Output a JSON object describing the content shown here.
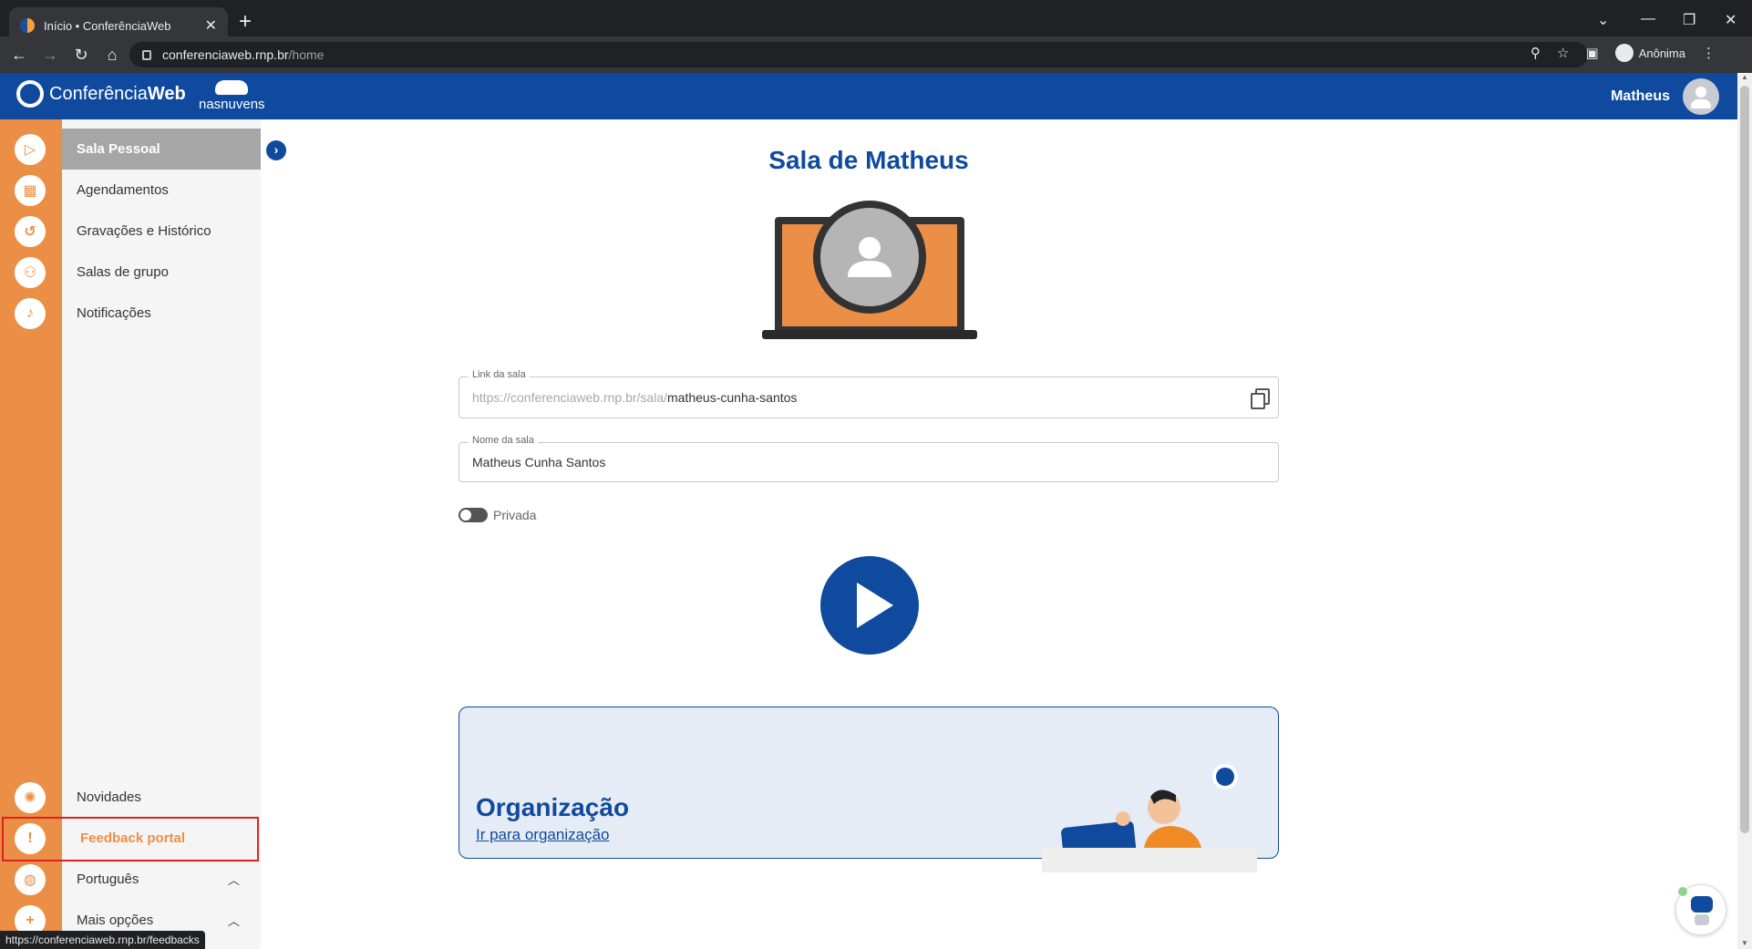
{
  "browser": {
    "tab_title": "Início • ConferênciaWeb",
    "url_host": "conferenciaweb.rnp.br",
    "url_path": "/home",
    "profile_label": "Anônima",
    "status_url": "https://conferenciaweb.rnp.br/feedbacks"
  },
  "header": {
    "logo_text_light": "Conferência",
    "logo_text_bold": "Web",
    "partner_logo": "nasnuvens",
    "user_name": "Matheus"
  },
  "sidebar": {
    "items": [
      {
        "label": "Sala Pessoal",
        "icon": "play-icon",
        "active": true
      },
      {
        "label": "Agendamentos",
        "icon": "calendar-icon"
      },
      {
        "label": "Gravações e Histórico",
        "icon": "history-icon"
      },
      {
        "label": "Salas de grupo",
        "icon": "group-icon"
      },
      {
        "label": "Notificações",
        "icon": "bell-icon"
      }
    ],
    "bottom_items": [
      {
        "label": "Novidades",
        "icon": "lightbulb-icon"
      },
      {
        "label": "Feedback portal",
        "icon": "feedback-icon"
      },
      {
        "label": "Português",
        "icon": "globe-icon"
      },
      {
        "label": "Mais opções",
        "icon": "plus-icon"
      }
    ]
  },
  "main": {
    "title": "Sala de Matheus",
    "link_field": {
      "legend": "Link da sala",
      "prefix": "https://conferenciaweb.rnp.br/sala/",
      "slug": "matheus-cunha-santos"
    },
    "name_field": {
      "legend": "Nome da sala",
      "value": "Matheus Cunha Santos"
    },
    "private_toggle": {
      "label": "Privada",
      "checked": false
    },
    "org_card": {
      "title": "Organização",
      "link": "Ir para organização"
    }
  },
  "colors": {
    "brand_blue": "#0f4a9e",
    "accent_orange": "#ec8f46",
    "active_gray": "#a6a6a6",
    "highlight_red": "#e02020"
  }
}
